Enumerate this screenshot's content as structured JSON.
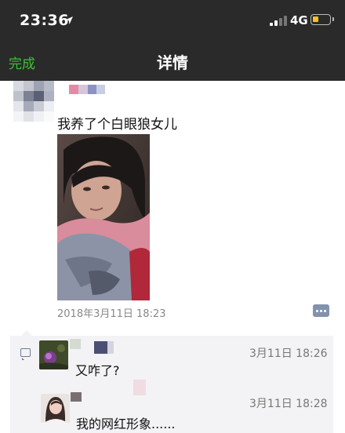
{
  "status_bar": {
    "time": "23:36",
    "network": "4G",
    "icons": [
      "location-icon",
      "signal-icon",
      "battery-icon"
    ]
  },
  "nav": {
    "done_label": "完成",
    "title": "详情"
  },
  "post": {
    "text": "我养了个白眼狼女儿",
    "timestamp": "2018年3月11日 18:23",
    "actions_icon": "comment-dots-icon"
  },
  "comments": [
    {
      "text": "又咋了?",
      "time": "3月11日 18:26"
    },
    {
      "text": "我的网红形象......",
      "time": "3月11日 18:28"
    }
  ],
  "colors": {
    "nav_bg": "#2a2a2a",
    "done_green": "#3cc13b",
    "comment_bg": "#f3f3f5",
    "meta_gray": "#888888"
  }
}
